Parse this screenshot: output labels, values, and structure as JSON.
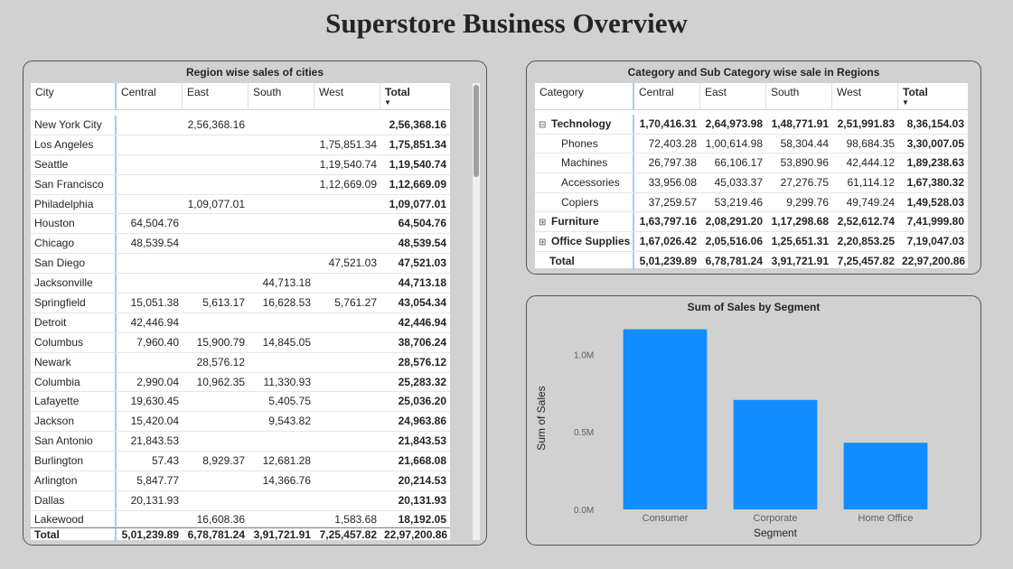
{
  "title": "Superstore Business Overview",
  "city_table": {
    "title": "Region wise sales of cities",
    "columns": [
      "City",
      "Central",
      "East",
      "South",
      "West",
      "Total"
    ],
    "rows": [
      [
        "New York City",
        "",
        "2,56,368.16",
        "",
        "",
        "2,56,368.16"
      ],
      [
        "Los Angeles",
        "",
        "",
        "",
        "1,75,851.34",
        "1,75,851.34"
      ],
      [
        "Seattle",
        "",
        "",
        "",
        "1,19,540.74",
        "1,19,540.74"
      ],
      [
        "San Francisco",
        "",
        "",
        "",
        "1,12,669.09",
        "1,12,669.09"
      ],
      [
        "Philadelphia",
        "",
        "1,09,077.01",
        "",
        "",
        "1,09,077.01"
      ],
      [
        "Houston",
        "64,504.76",
        "",
        "",
        "",
        "64,504.76"
      ],
      [
        "Chicago",
        "48,539.54",
        "",
        "",
        "",
        "48,539.54"
      ],
      [
        "San Diego",
        "",
        "",
        "",
        "47,521.03",
        "47,521.03"
      ],
      [
        "Jacksonville",
        "",
        "",
        "44,713.18",
        "",
        "44,713.18"
      ],
      [
        "Springfield",
        "15,051.38",
        "5,613.17",
        "16,628.53",
        "5,761.27",
        "43,054.34"
      ],
      [
        "Detroit",
        "42,446.94",
        "",
        "",
        "",
        "42,446.94"
      ],
      [
        "Columbus",
        "7,960.40",
        "15,900.79",
        "14,845.05",
        "",
        "38,706.24"
      ],
      [
        "Newark",
        "",
        "28,576.12",
        "",
        "",
        "28,576.12"
      ],
      [
        "Columbia",
        "2,990.04",
        "10,962.35",
        "11,330.93",
        "",
        "25,283.32"
      ],
      [
        "Lafayette",
        "19,630.45",
        "",
        "5,405.75",
        "",
        "25,036.20"
      ],
      [
        "Jackson",
        "15,420.04",
        "",
        "9,543.82",
        "",
        "24,963.86"
      ],
      [
        "San Antonio",
        "21,843.53",
        "",
        "",
        "",
        "21,843.53"
      ],
      [
        "Burlington",
        "57.43",
        "8,929.37",
        "12,681.28",
        "",
        "21,668.08"
      ],
      [
        "Arlington",
        "5,847.77",
        "",
        "14,366.76",
        "",
        "20,214.53"
      ],
      [
        "Dallas",
        "20,131.93",
        "",
        "",
        "",
        "20,131.93"
      ],
      [
        "Lakewood",
        "",
        "16,608.36",
        "",
        "1,583.68",
        "18,192.05"
      ]
    ],
    "total": [
      "Total",
      "5,01,239.89",
      "6,78,781.24",
      "3,91,721.91",
      "7,25,457.82",
      "22,97,200.86"
    ]
  },
  "category_table": {
    "title": "Category and Sub Category wise sale in Regions",
    "columns": [
      "Category",
      "Central",
      "East",
      "South",
      "West",
      "Total"
    ],
    "rows": [
      {
        "level": 0,
        "expand": "⊟",
        "cells": [
          "Technology",
          "1,70,416.31",
          "2,64,973.98",
          "1,48,771.91",
          "2,51,991.83",
          "8,36,154.03"
        ]
      },
      {
        "level": 1,
        "expand": "",
        "cells": [
          "Phones",
          "72,403.28",
          "1,00,614.98",
          "58,304.44",
          "98,684.35",
          "3,30,007.05"
        ]
      },
      {
        "level": 1,
        "expand": "",
        "cells": [
          "Machines",
          "26,797.38",
          "66,106.17",
          "53,890.96",
          "42,444.12",
          "1,89,238.63"
        ]
      },
      {
        "level": 1,
        "expand": "",
        "cells": [
          "Accessories",
          "33,956.08",
          "45,033.37",
          "27,276.75",
          "61,114.12",
          "1,67,380.32"
        ]
      },
      {
        "level": 1,
        "expand": "",
        "cells": [
          "Copiers",
          "37,259.57",
          "53,219.46",
          "9,299.76",
          "49,749.24",
          "1,49,528.03"
        ]
      },
      {
        "level": 0,
        "expand": "⊞",
        "cells": [
          "Furniture",
          "1,63,797.16",
          "2,08,291.20",
          "1,17,298.68",
          "2,52,612.74",
          "7,41,999.80"
        ]
      },
      {
        "level": 0,
        "expand": "⊞",
        "cells": [
          "Office Supplies",
          "1,67,026.42",
          "2,05,516.06",
          "1,25,651.31",
          "2,20,853.25",
          "7,19,047.03"
        ]
      }
    ],
    "total": [
      "Total",
      "5,01,239.89",
      "6,78,781.24",
      "3,91,721.91",
      "7,25,457.82",
      "22,97,200.86"
    ]
  },
  "chart_data": {
    "type": "bar",
    "title": "Sum of Sales by Segment",
    "xlabel": "Segment",
    "ylabel": "Sum of Sales",
    "categories": [
      "Consumer",
      "Corporate",
      "Home Office"
    ],
    "values": [
      1161401,
      706146,
      429653
    ],
    "ylim": [
      0,
      1200000
    ],
    "yticks": [
      0,
      500000,
      1000000
    ],
    "ytick_labels": [
      "0.0M",
      "0.5M",
      "1.0M"
    ],
    "bar_color": "#118dff"
  }
}
